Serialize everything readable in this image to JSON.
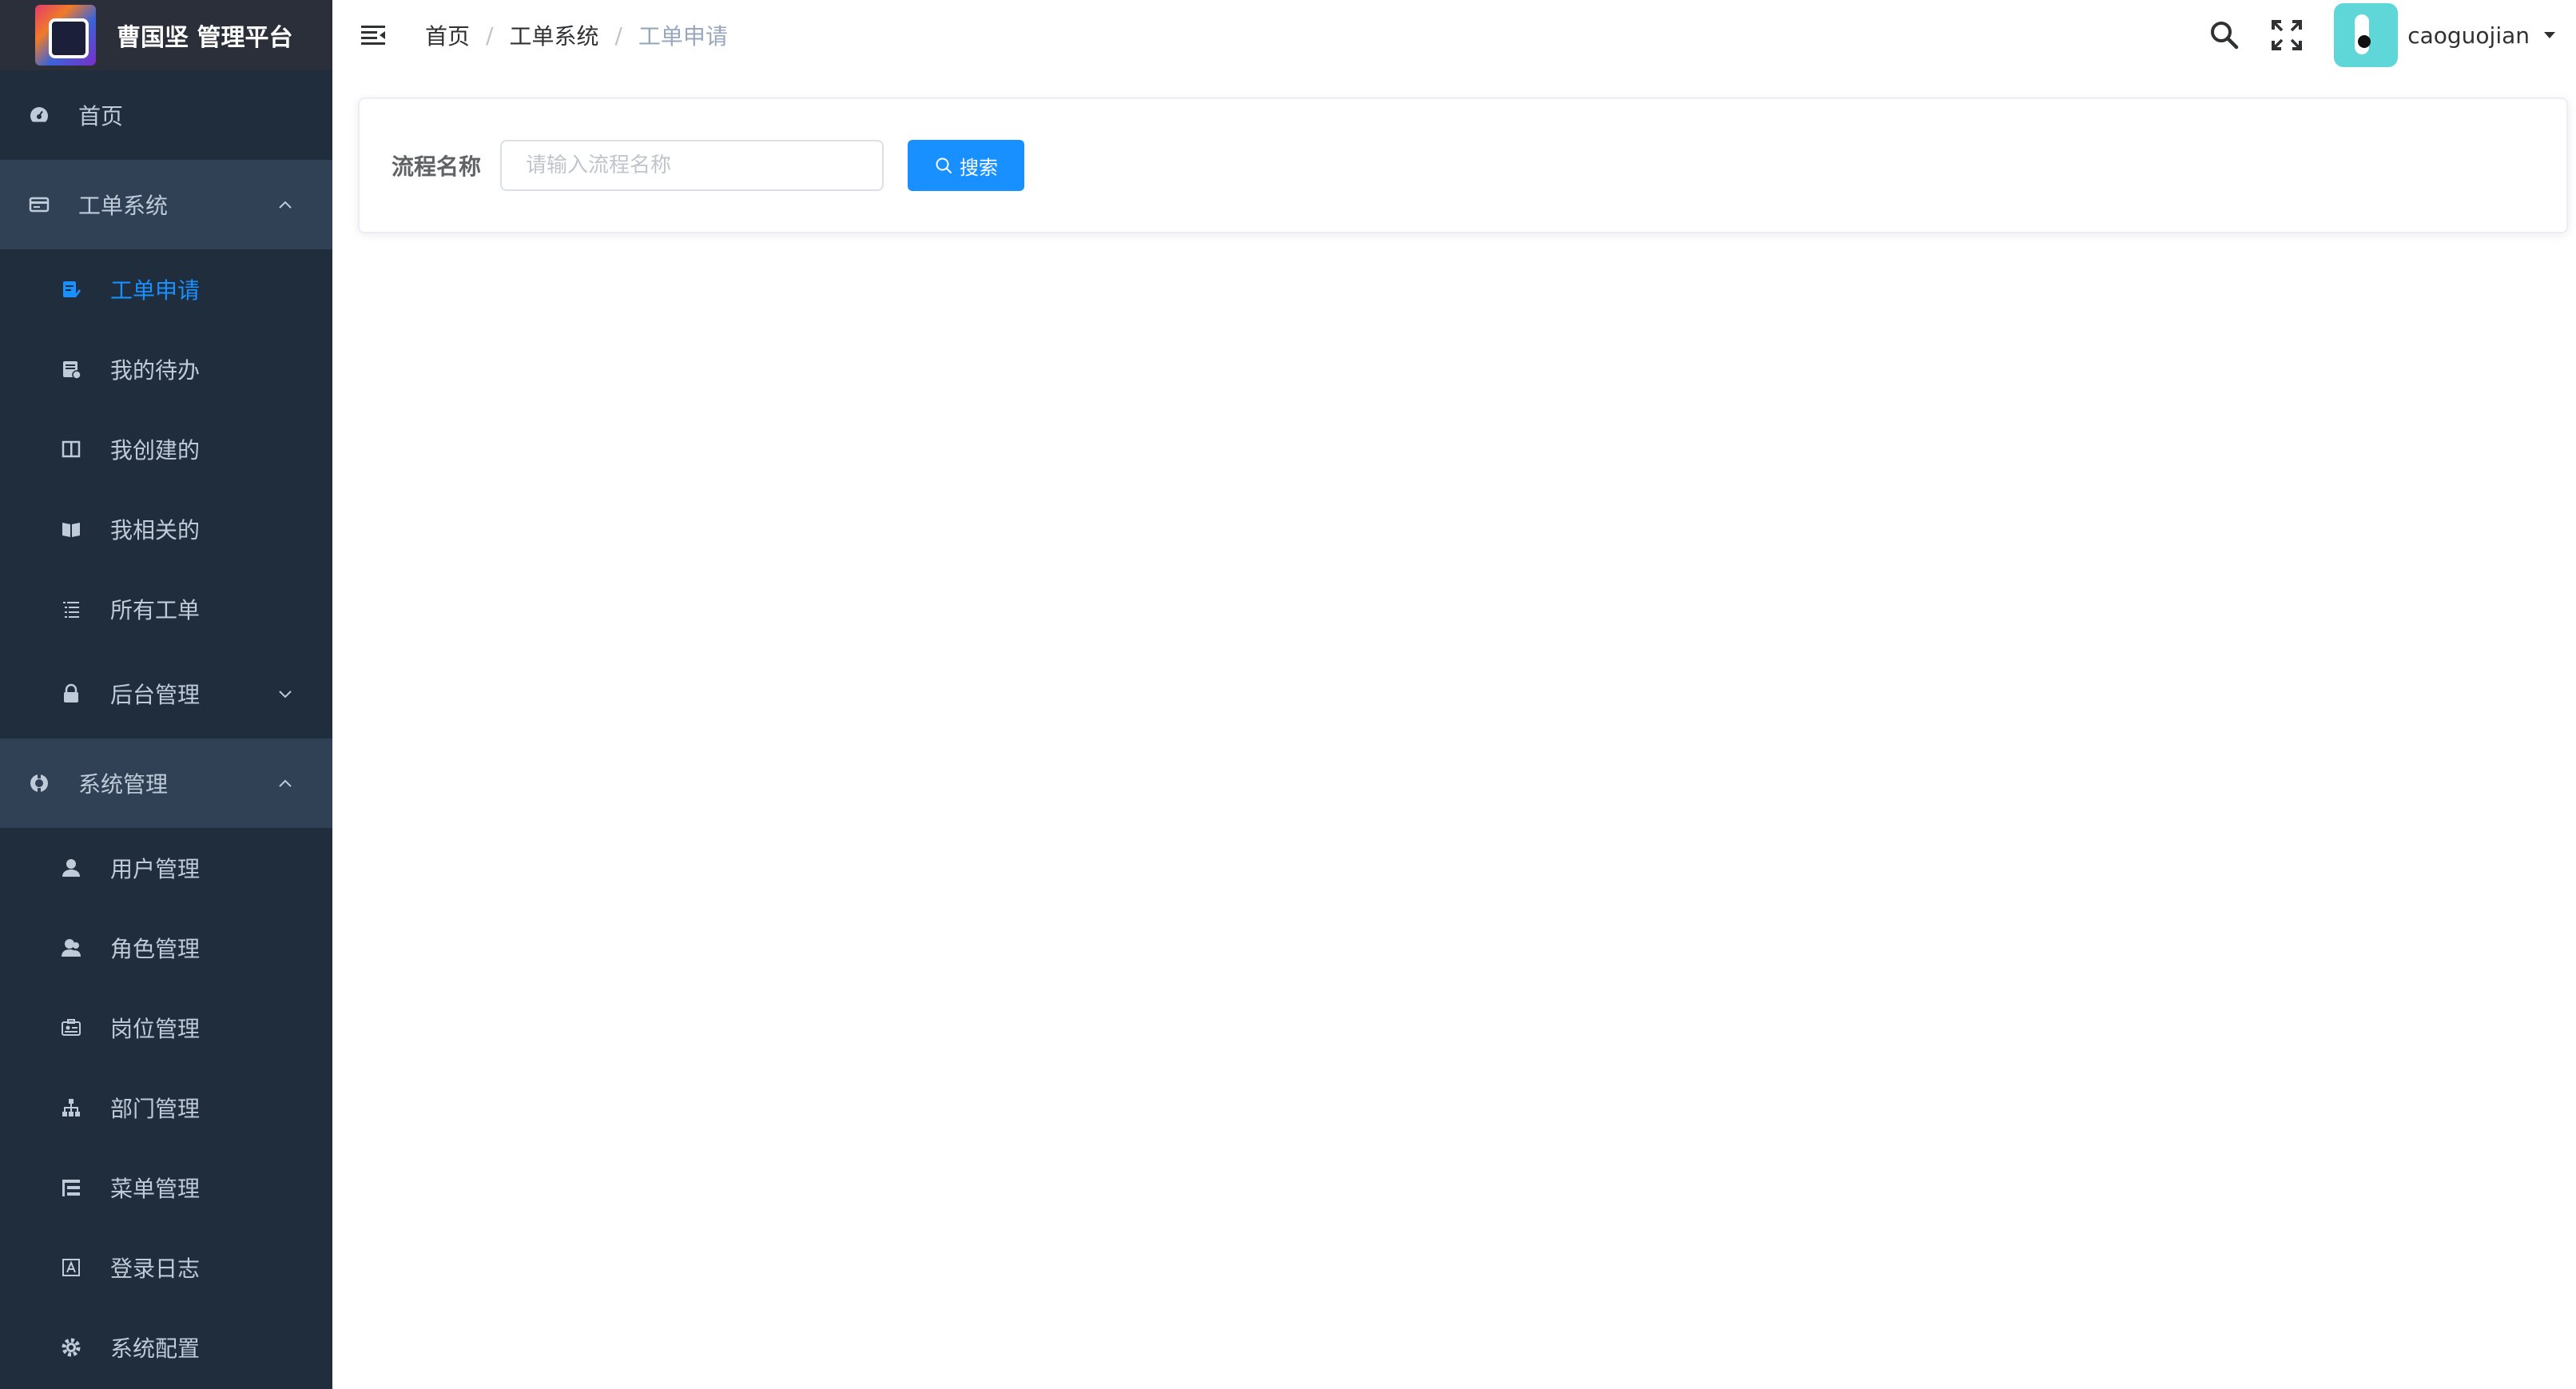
{
  "app": {
    "title": "曹国坚 管理平台"
  },
  "sidebar": {
    "items": [
      {
        "key": "home",
        "label": "首页",
        "icon": "dashboard-icon"
      },
      {
        "key": "ticket-system",
        "label": "工单系统",
        "icon": "ticket-icon",
        "expanded": true,
        "children": [
          {
            "label": "工单申请",
            "icon": "form-edit-icon",
            "active": true
          },
          {
            "label": "我的待办",
            "icon": "todo-icon"
          },
          {
            "label": "我创建的",
            "icon": "columns-icon"
          },
          {
            "label": "我相关的",
            "icon": "book-icon"
          },
          {
            "label": "所有工单",
            "icon": "list-icon"
          },
          {
            "label": "后台管理",
            "icon": "lock-icon",
            "expandable": true
          }
        ]
      },
      {
        "key": "system-management",
        "label": "系统管理",
        "icon": "system-icon",
        "expanded": true,
        "children": [
          {
            "label": "用户管理",
            "icon": "user-icon"
          },
          {
            "label": "角色管理",
            "icon": "peoples-icon"
          },
          {
            "label": "岗位管理",
            "icon": "post-icon"
          },
          {
            "label": "部门管理",
            "icon": "tree-icon"
          },
          {
            "label": "菜单管理",
            "icon": "tree-table-icon"
          },
          {
            "label": "登录日志",
            "icon": "log-icon"
          },
          {
            "label": "系统配置",
            "icon": "gear-icon"
          }
        ]
      }
    ]
  },
  "header": {
    "breadcrumb": [
      "首页",
      "工单系统",
      "工单申请"
    ],
    "breadcrumb_separator": "/",
    "username": "caoguojian"
  },
  "search_form": {
    "label": "流程名称",
    "input_value": "",
    "placeholder": "请输入流程名称",
    "button_label": "搜索"
  },
  "colors": {
    "sidebar_bg": "#1f2d3d",
    "sidebar_open_title_bg": "#304156",
    "logo_bar_bg": "#2b2f3a",
    "menu_text": "#bfcbd9",
    "accent": "#1890ff",
    "avatar_bg": "#5fd6d8"
  }
}
